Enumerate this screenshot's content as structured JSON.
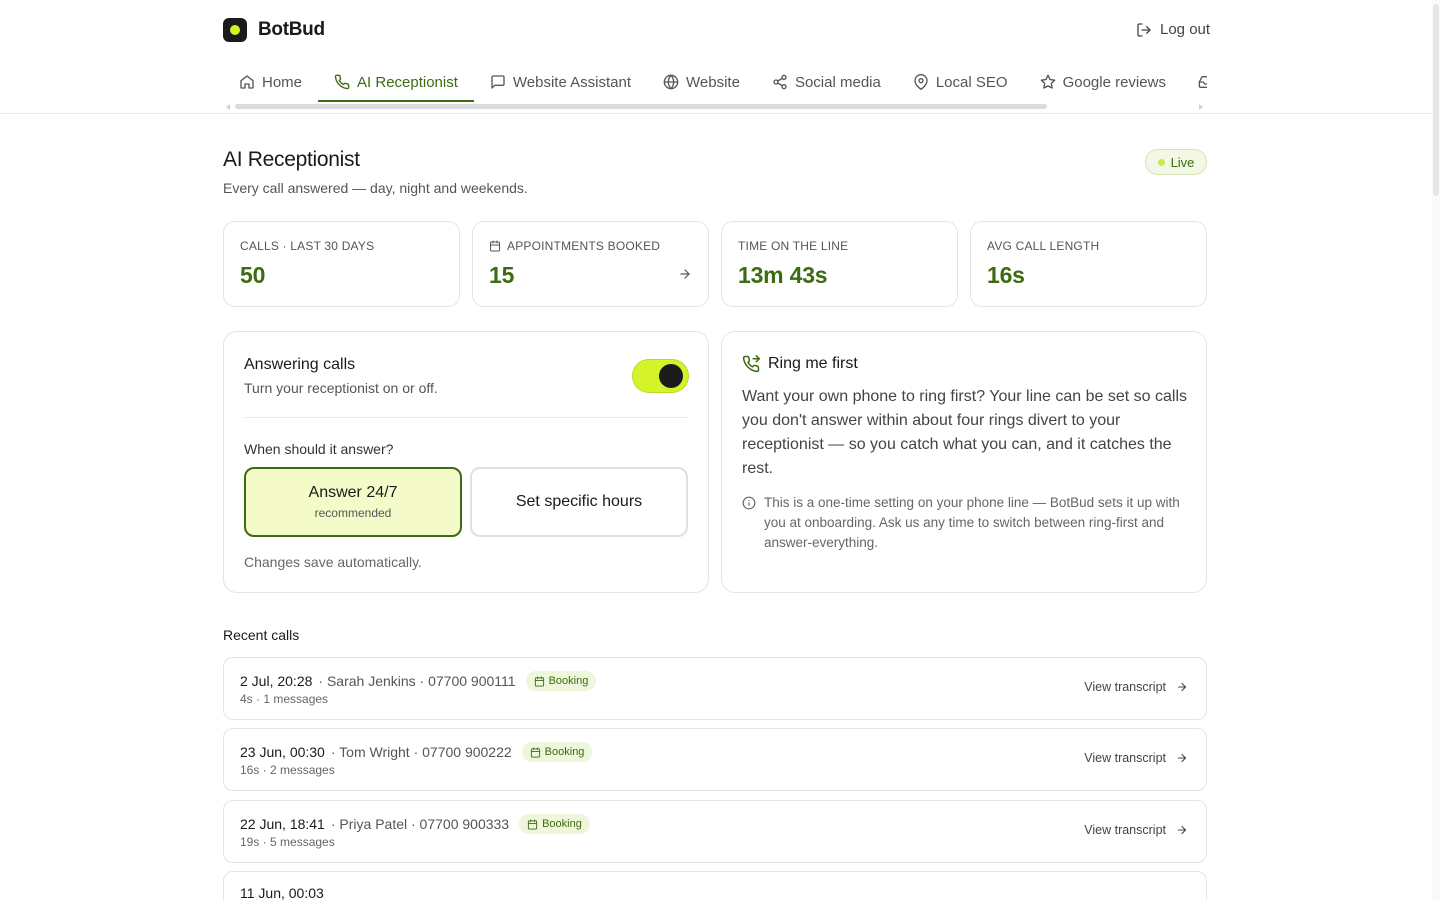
{
  "brand": {
    "name": "BotBud"
  },
  "header": {
    "logout": "Log out"
  },
  "nav": {
    "items": [
      {
        "label": "Home",
        "icon": "home-icon"
      },
      {
        "label": "AI Receptionist",
        "icon": "phone-icon",
        "active": true
      },
      {
        "label": "Website Assistant",
        "icon": "chat-icon"
      },
      {
        "label": "Website",
        "icon": "globe-icon"
      },
      {
        "label": "Social media",
        "icon": "share-icon"
      },
      {
        "label": "Local SEO",
        "icon": "map-pin-icon"
      },
      {
        "label": "Google reviews",
        "icon": "star-icon"
      },
      {
        "label": "",
        "icon": "inbox-icon"
      }
    ]
  },
  "page": {
    "title": "AI Receptionist",
    "subtitle": "Every call answered — day, night and weekends.",
    "status": "Live"
  },
  "stats": [
    {
      "label": "CALLS · LAST 30 DAYS",
      "value": "50"
    },
    {
      "label": "APPOINTMENTS BOOKED",
      "value": "15"
    },
    {
      "label": "TIME ON THE LINE",
      "value": "13m 43s"
    },
    {
      "label": "AVG CALL LENGTH",
      "value": "16s"
    }
  ],
  "answering": {
    "title": "Answering calls",
    "subtitle": "Turn your receptionist on or off.",
    "enabled": true,
    "when_label": "When should it answer?",
    "option_a": "Answer 24/7",
    "option_a_sub": "recommended",
    "option_b": "Set specific hours",
    "save_note": "Changes save automatically."
  },
  "ring_first": {
    "title": "Ring me first",
    "body": "Want your own phone to ring first? Your line can be set so calls you don't answer within about four rings divert to your receptionist — so you catch what you can, and it catches the rest.",
    "note": "This is a one-time setting on your phone line — BotBud sets it up with you at onboarding. Ask us any time to switch between ring-first and answer-everything."
  },
  "recent_calls": {
    "title": "Recent calls",
    "action_label": "View transcript",
    "items": [
      {
        "time": "2 Jul, 20:28",
        "meta": "· Sarah Jenkins · 07700 900111",
        "tag": "Booking",
        "detail": "4s · 1 messages"
      },
      {
        "time": "23 Jun, 00:30",
        "meta": "· Tom Wright · 07700 900222",
        "tag": "Booking",
        "detail": "16s · 2 messages"
      },
      {
        "time": "22 Jun, 18:41",
        "meta": "· Priya Patel · 07700 900333",
        "tag": "Booking",
        "detail": "19s · 5 messages"
      },
      {
        "time": "11 Jun, 00:03",
        "meta": "",
        "tag": "",
        "detail": ""
      }
    ]
  },
  "colors": {
    "accent": "#3d6b0f",
    "highlight": "#d6f32a",
    "highlight_bg": "#f4fbc8"
  }
}
